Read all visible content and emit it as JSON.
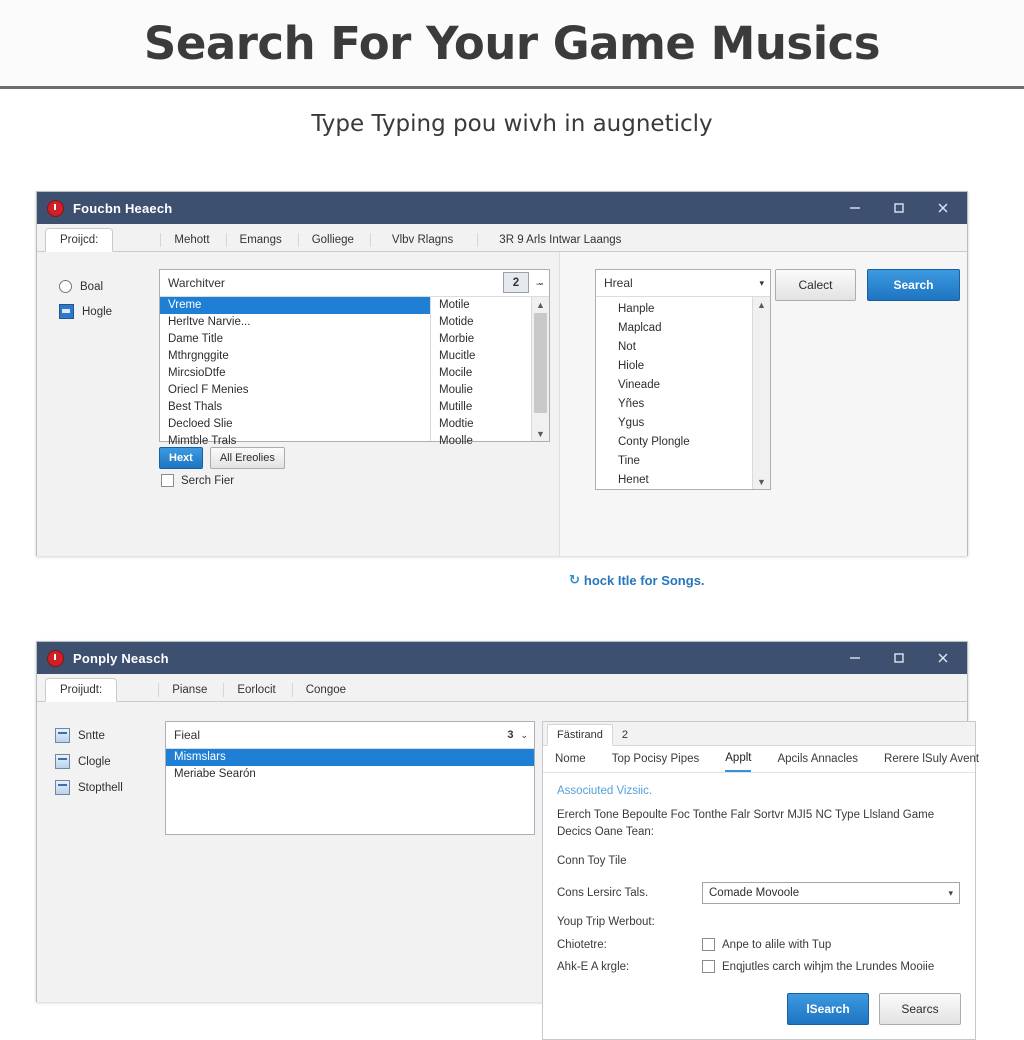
{
  "header": {
    "title": "Search For Your Game Musics",
    "subtitle": "Type Typing pou wivh in augneticly"
  },
  "window1": {
    "title": "Foucbn Heaech",
    "controls": {
      "minimize": "–",
      "maximize": "□",
      "close": "✕"
    },
    "tabs": [
      {
        "label": "Proijcd:",
        "active": true
      },
      {
        "label": "Mehott",
        "active": false
      },
      {
        "label": "Emangs",
        "active": false
      },
      {
        "label": "Golliege",
        "active": false
      },
      {
        "label": "Vlbv Rlagns",
        "active": false
      },
      {
        "label": "3R 9 Arls Intwar Laangs",
        "active": false
      }
    ],
    "rail": [
      {
        "label": "Boal",
        "type": "radio"
      },
      {
        "label": "Hogle",
        "type": "checkbox-blue"
      }
    ],
    "listbox": {
      "header": "Warchitver",
      "header_minus": "–",
      "spinner_value": "2",
      "spinner_caret": "⌄",
      "items_left": [
        "Vreme",
        "Herltve Narvie...",
        "Dame Title",
        "Mthrgnggite",
        "MircsioDtfe",
        "Oriecl F Menies",
        "Best Thals",
        "Decloed Slie",
        "Mimtble Trals"
      ],
      "selected_index": 0,
      "items_right": [
        "Motile",
        "Motide",
        "Morbie",
        "Mucitle",
        "Mocile",
        "Moulie",
        "Mutille",
        "Modtie",
        "Moolle"
      ],
      "scroll_up": "▲",
      "scroll_down": "▼"
    },
    "buttons": {
      "primary_small": "Hext",
      "secondary_small": "All Ereolies",
      "checkbox_label": "Serch Fier",
      "cancel": "Calect",
      "search": "Search"
    },
    "dropdown": {
      "header": "Hreal",
      "caret": "▾",
      "items": [
        "Hanple",
        "Maplcad",
        "Not",
        "Hiole",
        "Vineade",
        "Yñes",
        "Ygus",
        "Conty Plongle",
        "Tine",
        "Henet"
      ],
      "scroll_up": "▲",
      "scroll_down": "▼"
    },
    "link": {
      "glyph": "↻",
      "text": "hock Itle for Songs."
    }
  },
  "window2": {
    "title": "Ponply Neasch",
    "controls": {
      "minimize": "–",
      "maximize": "□",
      "close": "✕"
    },
    "tabs": [
      {
        "label": "Proijudt:",
        "active": true
      },
      {
        "label": "Pianse",
        "active": false
      },
      {
        "label": "Eorlocit",
        "active": false
      },
      {
        "label": "Congoe",
        "active": false
      }
    ],
    "rail": [
      {
        "label": "Sntte"
      },
      {
        "label": "Clogle"
      },
      {
        "label": "Stopthell"
      }
    ],
    "listbox": {
      "header": "Fieal",
      "spinner_value": "3",
      "spinner_caret": "⌄",
      "items": [
        "Mismslars",
        "Meriabe Searón"
      ],
      "selected_index": 0
    },
    "panel": {
      "tabs": [
        {
          "label": "Fästirand",
          "active": true
        },
        {
          "label": "2",
          "active": false
        }
      ],
      "subtabs": [
        {
          "label": "Nome",
          "active": false
        },
        {
          "label": "Top Pocisy Pipes",
          "active": false
        },
        {
          "label": "Applt",
          "active": true
        },
        {
          "label": "Apcils Annacles",
          "active": false
        },
        {
          "label": "Rerere lSuly Avent",
          "active": false
        }
      ],
      "title": "Associuted Vizsiic.",
      "body": "Ererch Tone Bepoulte Foc Tonthe Falr Sortvr MJI5 NC Type Llsland Game Decics Oane Tean:",
      "line2": "Conn Toy Tile",
      "field_label": "Cons Lersirc Tals.",
      "field_value": "Comade Movoole",
      "field_caret": "▾",
      "labels": [
        "Youp Trip Werbout:",
        "Chiotetre:",
        "Ahk-E A krgle:"
      ],
      "checkboxes": [
        "Anpe to alile with Tup",
        "Enqjutles carch wihjm the Lrundes Mooiie"
      ],
      "buttons": {
        "primary": "lSearch",
        "secondary": "Searcs"
      }
    }
  }
}
